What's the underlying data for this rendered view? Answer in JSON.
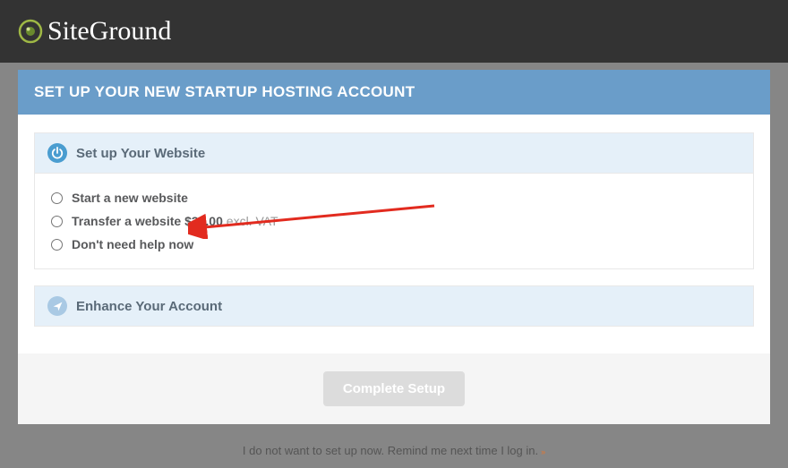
{
  "brand": {
    "name": "SiteGround"
  },
  "panel": {
    "title": "SET UP YOUR NEW STARTUP HOSTING ACCOUNT"
  },
  "section_setup": {
    "title": "Set up Your Website",
    "options": {
      "start": "Start a new website",
      "transfer_prefix": "Transfer a website ",
      "transfer_price": "$30.00 ",
      "transfer_vat": "excl. VAT",
      "nohelp": "Don't need help now"
    }
  },
  "section_enhance": {
    "title": "Enhance Your Account"
  },
  "actions": {
    "complete": "Complete Setup",
    "skip": "I do not want to set up now. Remind me next time I log in."
  }
}
